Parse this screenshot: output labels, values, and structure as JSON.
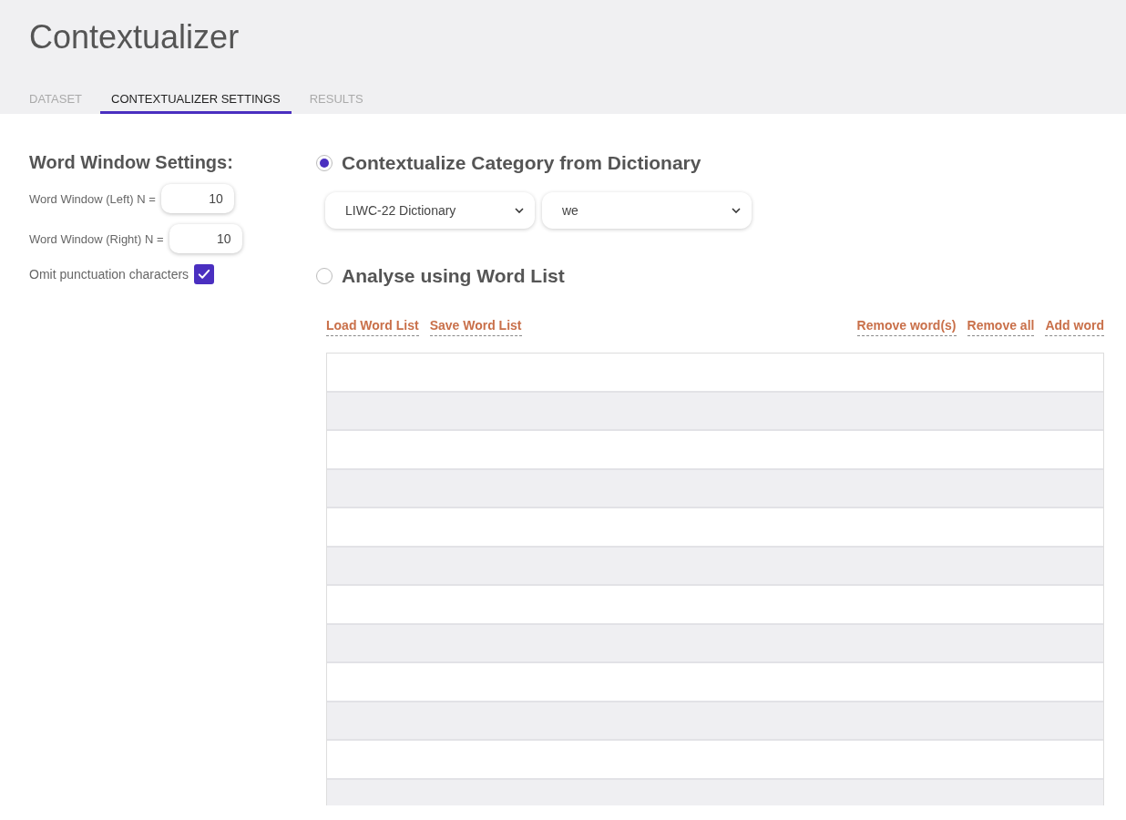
{
  "app_title": "Contextualizer",
  "tabs": [
    {
      "label": "DATASET",
      "selected": false
    },
    {
      "label": "CONTEXTUALIZER SETTINGS",
      "selected": true
    },
    {
      "label": "RESULTS",
      "selected": false
    }
  ],
  "word_window": {
    "heading": "Word Window Settings:",
    "fields": [
      {
        "label": "Word Window (Left) N =",
        "value": "10"
      },
      {
        "label": "Word Window (Right) N =",
        "value": "10"
      }
    ],
    "omit_punctuation": {
      "label": "Omit punctuation characters",
      "checked": true
    }
  },
  "modes": [
    {
      "label": "Contextualize Category from Dictionary",
      "selected": true
    },
    {
      "label": "Analyse using Word List",
      "selected": false
    }
  ],
  "dictionary_select": "LIWC-22 Dictionary",
  "category_select": "we",
  "word_list_actions_left": [
    "Load Word List",
    "Save Word List"
  ],
  "word_list_actions_right": [
    "Remove word(s)",
    "Remove all",
    "Add word"
  ]
}
